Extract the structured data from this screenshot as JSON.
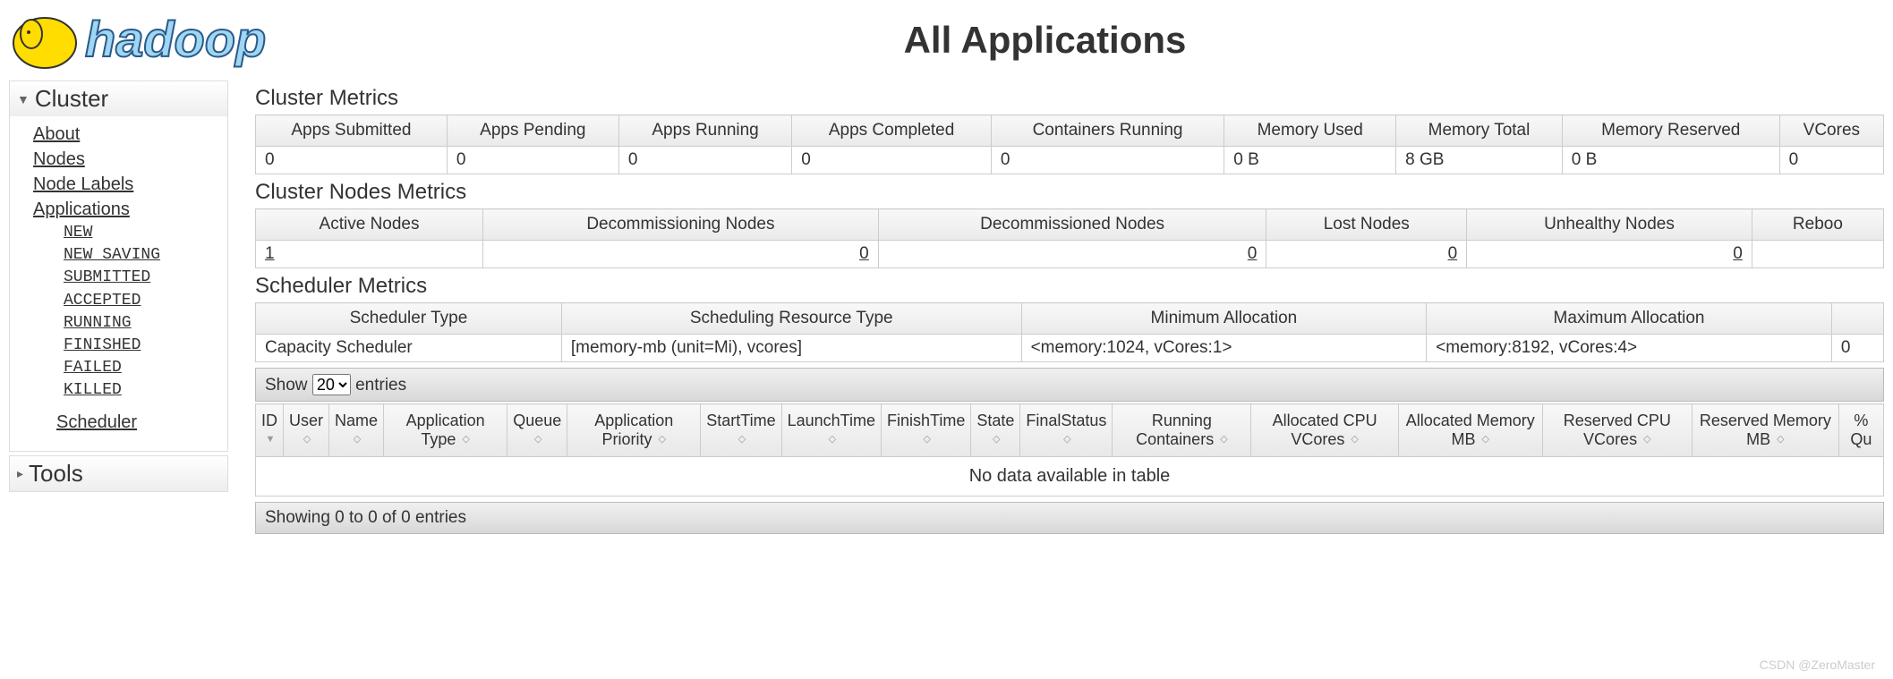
{
  "page_title": "All Applications",
  "logo_text": "hadoop",
  "sidebar": {
    "cluster_header": "Cluster",
    "tools_header": "Tools",
    "links": {
      "about": "About",
      "nodes": "Nodes",
      "node_labels": "Node Labels",
      "applications": "Applications",
      "scheduler": "Scheduler"
    },
    "app_states": [
      "NEW",
      "NEW_SAVING",
      "SUBMITTED",
      "ACCEPTED",
      "RUNNING",
      "FINISHED",
      "FAILED",
      "KILLED"
    ]
  },
  "cluster_metrics": {
    "title": "Cluster Metrics",
    "headers": [
      "Apps Submitted",
      "Apps Pending",
      "Apps Running",
      "Apps Completed",
      "Containers Running",
      "Memory Used",
      "Memory Total",
      "Memory Reserved",
      "VCores"
    ],
    "values": [
      "0",
      "0",
      "0",
      "0",
      "0",
      "0 B",
      "8 GB",
      "0 B",
      "0"
    ]
  },
  "nodes_metrics": {
    "title": "Cluster Nodes Metrics",
    "headers": [
      "Active Nodes",
      "Decommissioning Nodes",
      "Decommissioned Nodes",
      "Lost Nodes",
      "Unhealthy Nodes",
      "Reboo"
    ],
    "values": [
      "1",
      "0",
      "0",
      "0",
      "0",
      ""
    ]
  },
  "scheduler_metrics": {
    "title": "Scheduler Metrics",
    "headers": [
      "Scheduler Type",
      "Scheduling Resource Type",
      "Minimum Allocation",
      "Maximum Allocation",
      ""
    ],
    "values": [
      "Capacity Scheduler",
      "[memory-mb (unit=Mi), vcores]",
      "<memory:1024, vCores:1>",
      "<memory:8192, vCores:4>",
      "0"
    ]
  },
  "datatable": {
    "show_label": "Show",
    "entries_label": "entries",
    "page_size": "20",
    "columns": [
      "ID",
      "User",
      "Name",
      "Application Type",
      "Queue",
      "Application Priority",
      "StartTime",
      "LaunchTime",
      "FinishTime",
      "State",
      "FinalStatus",
      "Running Containers",
      "Allocated CPU VCores",
      "Allocated Memory MB",
      "Reserved CPU VCores",
      "Reserved Memory MB",
      "% Qu"
    ],
    "no_data": "No data available in table",
    "info": "Showing 0 to 0 of 0 entries"
  },
  "watermark": "CSDN @ZeroMaster"
}
